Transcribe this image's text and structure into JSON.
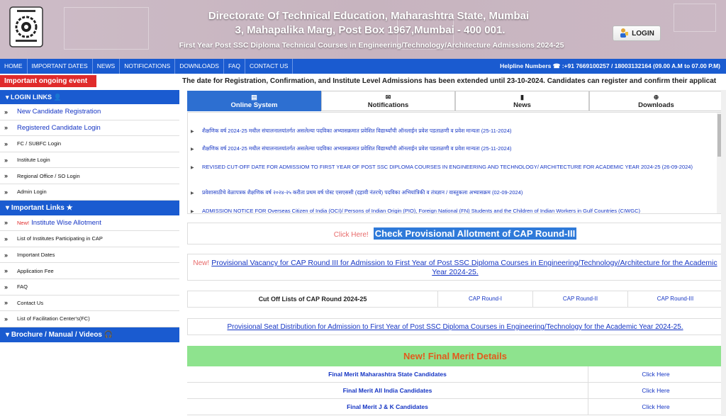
{
  "header": {
    "line1": "Directorate Of Technical Education, Maharashtra State, Mumbai",
    "line2": "3, Mahapalika Marg, Post Box 1967,Mumbai - 400 001.",
    "line3": "First Year Post SSC Diploma Technical Courses in Engineering/Technology/Architecture Admissions 2024-25",
    "login_label": "LOGIN"
  },
  "nav": {
    "items": [
      "HOME",
      "IMPORTANT DATES",
      "NEWS",
      "NOTIFICATIONS",
      "DOWNLOADS",
      "FAQ",
      "CONTACT US"
    ],
    "helpline": "Helpline Numbers ☎ :+91 7669100257 / 18003132164    (09.00 A.M to 07.00 P.M)"
  },
  "ongoing": {
    "label": "Important ongoing event",
    "ticker": "The date for Registration, Confirmation, and Institute Level Admissions has been extended until 23-10-2024. Candidates can register and confirm their applicat"
  },
  "sidebar": {
    "login_head": "LOGIN LINKS",
    "login_items": [
      "New Candidate Registration",
      "Registered Candidate Login",
      "FC / SUBFC Login",
      "Institute Login",
      "Regional Office / SO Login",
      "Admin Login"
    ],
    "important_head": "Important Links",
    "important_new": "New!",
    "important_items": [
      "Institute Wise Allotment",
      "List of Institutes Participating in CAP",
      "Important Dates",
      "Application Fee",
      "FAQ",
      "Contact Us",
      "List of Facilitation Center's(FC)"
    ],
    "brochure_head": "Brochure / Manual / Videos"
  },
  "tabs": [
    {
      "label": "Online System",
      "icon": "monitor-icon"
    },
    {
      "label": "Notifications",
      "icon": "envelope-icon"
    },
    {
      "label": "News",
      "icon": "news-icon"
    },
    {
      "label": "Downloads",
      "icon": "download-icon"
    }
  ],
  "news": [
    "शैक्षणिक वर्ष 2024-25 मधील संचालनालयांतर्गत असलेल्या पदविका अभ्यासक्रमात प्रवेशित विद्यार्थ्यांची ऑनलाईन प्रवेश पडताळणी व प्रवेश मान्यता (25-11-2024)",
    "शैक्षणिक वर्ष 2024-25 मधील संचालनालयांतर्गत असलेल्या पदविका अभ्यासक्रमात प्रवेशित विद्यार्थ्यांची ऑनलाईन प्रवेश पडताळणी व प्रवेश मान्यता (25-11-2024)",
    "REVISED CUT-OFF DATE FOR ADMISSIOM TO FIRST YEAR OF POST SSC DIPLOMA COURSES IN ENGINEERING AND TECHNOLOGY/ ARCHITECTURE FOR ACADEMIC YEAR 2024-25 (26-09-2024)",
    "प्रवेशासाठीचे वेळापत्रक शैक्षणिक वर्ष २०२४-२५ करीता प्रथम वर्ष पोस्ट एसएससी (दहावी नंतरचे) पदविका अभियांत्रिकी व तंत्रज्ञान / वास्तुकला अभ्यासक्रम (02-09-2024)",
    "ADMISSION NOTICE FOR Overseas Citizen of India (OCI)/ Persons of Indian Origin (PIO), Foreign National (FN) Students and the Children of Indian Workers in Gulf Countries (CIWGC)"
  ],
  "cap": {
    "click_here": "Click Here!",
    "link": "Check Provisional Allotment of CAP Round-III"
  },
  "vacancy": {
    "new": "New!",
    "link": "Provisional Vacancy for CAP Round III for Admission to First Year of Post SSC Diploma Courses in Engineering/Technology/Architecture for the Academic Year 2024-25."
  },
  "cutoff": {
    "label": "Cut Off Lists of CAP Round 2024-25",
    "rounds": [
      "CAP Round-I",
      "CAP Round-II",
      "CAP Round-III"
    ]
  },
  "seat": {
    "link": "Provisional Seat Distribution for Admission to First Year of Post SSC Diploma Courses in Engineering/Technology for the Academic Year 2024-25."
  },
  "merit": {
    "new": "New!",
    "title": "Final Merit Details",
    "rows": [
      {
        "label": "Final Merit Maharashtra State Candidates",
        "action": "Click Here"
      },
      {
        "label": "Final Merit All India Candidates",
        "action": "Click Here"
      },
      {
        "label": "Final Merit J & K Candidates",
        "action": "Click Here"
      }
    ]
  },
  "colors": {
    "nav_blue": "#1a5bd0",
    "alert_red": "#e02b2b",
    "merit_green": "#8ee38e",
    "link_blue": "#1535c4"
  }
}
